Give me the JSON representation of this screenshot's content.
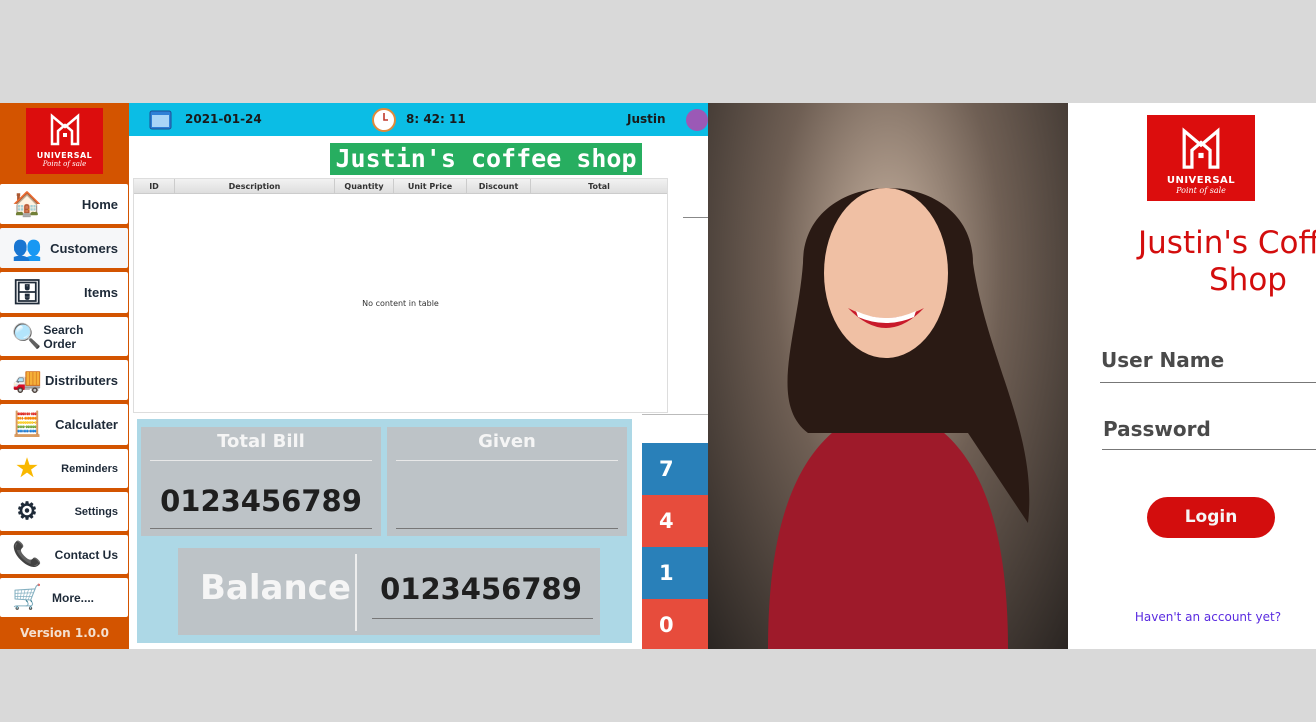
{
  "logo": {
    "line1": "UNIVERSAL",
    "line2": "Point of sale",
    "color": "#dc0d0d"
  },
  "sidebar": {
    "items": [
      {
        "label": "Home",
        "icon": "house-icon"
      },
      {
        "label": "Customers",
        "icon": "customers-icon"
      },
      {
        "label": "Items",
        "icon": "shelves-icon"
      },
      {
        "label": "Search Order",
        "icon": "magnifier-icon"
      },
      {
        "label": "Distributers",
        "icon": "truck-icon"
      },
      {
        "label": "Calculater",
        "icon": "calculator-icon"
      },
      {
        "label": "Reminders",
        "icon": "star-icon"
      },
      {
        "label": "Settings",
        "icon": "gears-icon"
      },
      {
        "label": "Contact Us",
        "icon": "phone-icon"
      },
      {
        "label": "More....",
        "icon": "cart-icon"
      }
    ],
    "version": "Version 1.0.0",
    "color": "#d35400"
  },
  "topbar": {
    "date": "2021-01-24",
    "time": "8: 42: 11",
    "user": "Justin",
    "color": "#0bbde5"
  },
  "shop_title": "Justin's coffee shop",
  "table": {
    "columns": [
      "ID",
      "Description",
      "Quantity",
      "Unit Price",
      "Discount",
      "Total"
    ],
    "empty_text": "No content in table"
  },
  "billing": {
    "total_bill_label": "Total Bill",
    "total_bill_value": "0123456789",
    "given_label": "Given",
    "given_value": "",
    "balance_label": "Balance",
    "balance_value": "0123456789"
  },
  "keypad": {
    "keys": [
      "7",
      "4",
      "1",
      "0"
    ]
  },
  "login": {
    "title": "Justin's Coffee Shop",
    "username_label": "User Name",
    "password_label": "Password",
    "login_button": "Login",
    "signup_link": "Haven't an account yet?"
  }
}
